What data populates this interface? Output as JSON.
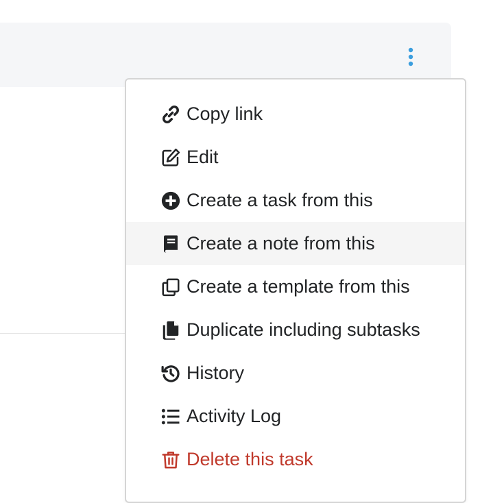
{
  "header": {
    "more_icon": "vertical-ellipsis-icon",
    "accent_color": "#3b9ede"
  },
  "menu": {
    "items": [
      {
        "label": "Copy link",
        "icon": "link-icon"
      },
      {
        "label": "Edit",
        "icon": "edit-icon"
      },
      {
        "label": "Create a task from this",
        "icon": "plus-circle-icon"
      },
      {
        "label": "Create a note from this",
        "icon": "book-icon",
        "state": "hovered"
      },
      {
        "label": "Create a template from this",
        "icon": "copy-icon"
      },
      {
        "label": "Duplicate including subtasks",
        "icon": "files-icon"
      },
      {
        "label": "History",
        "icon": "history-icon"
      },
      {
        "label": "Activity Log",
        "icon": "list-icon"
      },
      {
        "label": "Delete this task",
        "icon": "trash-icon",
        "color": "#c0392b"
      }
    ]
  }
}
